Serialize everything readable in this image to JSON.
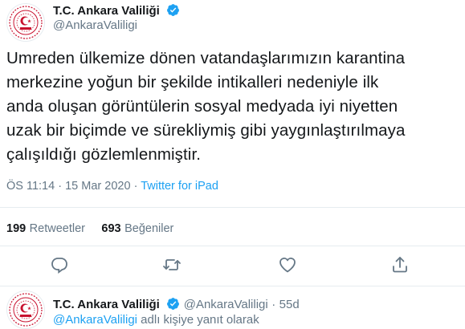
{
  "tweet": {
    "display_name": "T.C. Ankara Valiliği",
    "handle": "@AnkaraValiligi",
    "text_lines": [
      "Umreden ülkemize dönen vatandaşlarımızın karantina",
      "merkezine yoğun bir şekilde intikalleri nedeniyle ilk",
      "anda oluşan görüntülerin sosyal medyada iyi niyetten",
      "uzak bir biçimde ve sürekliymiş gibi yaygınlaştırılmaya",
      "çalışıldığı gözlemlenmiştir."
    ],
    "time": "ÖS 11:14",
    "separator": "·",
    "date": "15 Mar 2020",
    "source": "Twitter for iPad",
    "retweet_count": "199",
    "retweet_label": "Retweetler",
    "like_count": "693",
    "like_label": "Beğeniler"
  },
  "actions": {
    "reply_icon": "comment-icon",
    "retweet_icon": "retweet-icon",
    "like_icon": "heart-icon",
    "share_icon": "share-icon"
  },
  "reply_tweet": {
    "display_name": "T.C. Ankara Valiliği",
    "handle": "@AnkaraValiligi",
    "separator": "·",
    "age": "55d",
    "reply_to_handle": "@AnkaraValiligi",
    "reply_to_suffix": "adlı kişiye yanıt olarak"
  },
  "colors": {
    "accent": "#1da1f2",
    "muted": "#657786",
    "text": "#14171a",
    "divider": "#e6ecf0",
    "logo_red": "#c8102e"
  }
}
